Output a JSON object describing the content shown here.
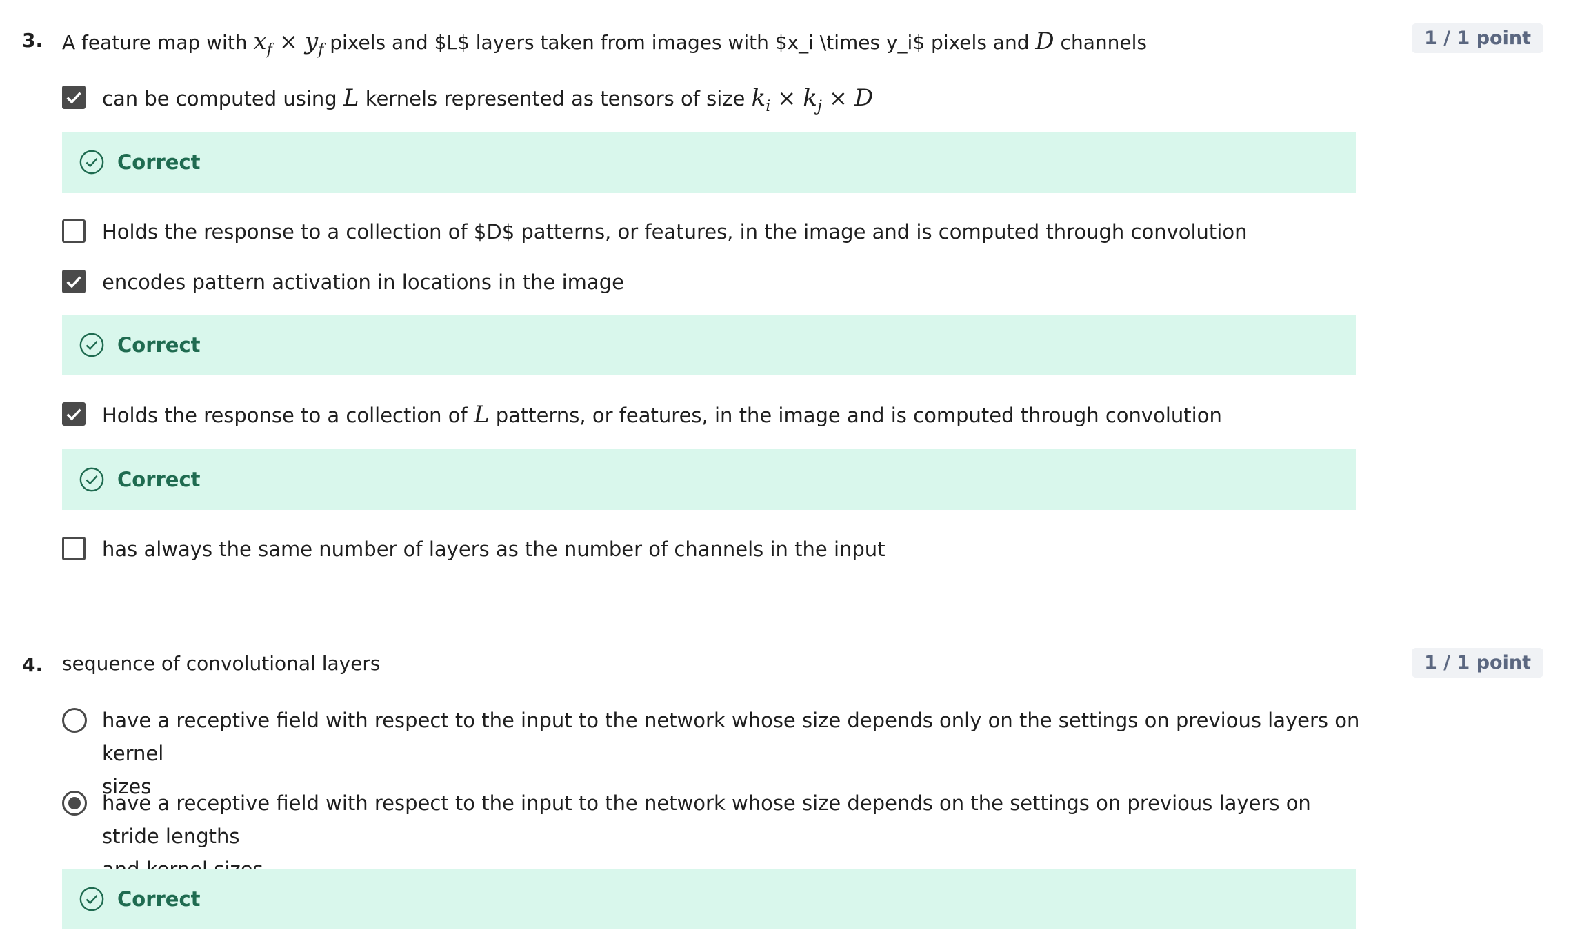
{
  "correct_color": "#1f6b50",
  "feedback_bg": "#d9f7ec",
  "icons": {
    "check": "check-mark-icon",
    "correct": "check-circle-icon"
  },
  "q3": {
    "number": "3.",
    "text_a": "A feature map with ",
    "x": "x",
    "f1": "f",
    "times1": " × ",
    "y": "y",
    "f2": "f",
    "text_b": " pixels and $L$ layers taken from images with $x_i \\times y_i$ pixels and ",
    "D": "D",
    "text_c": " channels",
    "points": "1 / 1 point",
    "options": [
      {
        "pre": "can be computed using ",
        "L": "L",
        "mid": " kernels represented as tensors of size ",
        "k1": "k",
        "i": "i",
        "times_a": " × ",
        "k2": "k",
        "j": "j",
        "times_b": " × ",
        "D": "D",
        "checked": true,
        "feedback": "Correct"
      },
      {
        "text": "Holds the response to a collection of $D$ patterns, or features, in the image and is computed through convolution",
        "checked": false
      },
      {
        "text": "encodes pattern activation in locations in the image",
        "checked": true,
        "feedback": "Correct"
      },
      {
        "pre": "Holds the response to a collection of ",
        "L": "L",
        "post": " patterns, or features, in the image and is computed through convolution",
        "checked": true,
        "feedback": "Correct"
      },
      {
        "text": "has always the same number of layers as the number of channels in the input",
        "checked": false
      }
    ]
  },
  "q4": {
    "number": "4.",
    "text": "sequence of convolutional layers",
    "points": "1 / 1 point",
    "options": [
      {
        "line1": "have a receptive field with respect to the input to the network whose size depends only on the settings on previous layers on kernel",
        "line2": "sizes",
        "selected": false
      },
      {
        "line1": "have a receptive field with respect to the input to the network whose size depends on the settings on previous layers on stride lengths",
        "line2": "and kernel sizes",
        "selected": true,
        "feedback": "Correct"
      }
    ]
  }
}
